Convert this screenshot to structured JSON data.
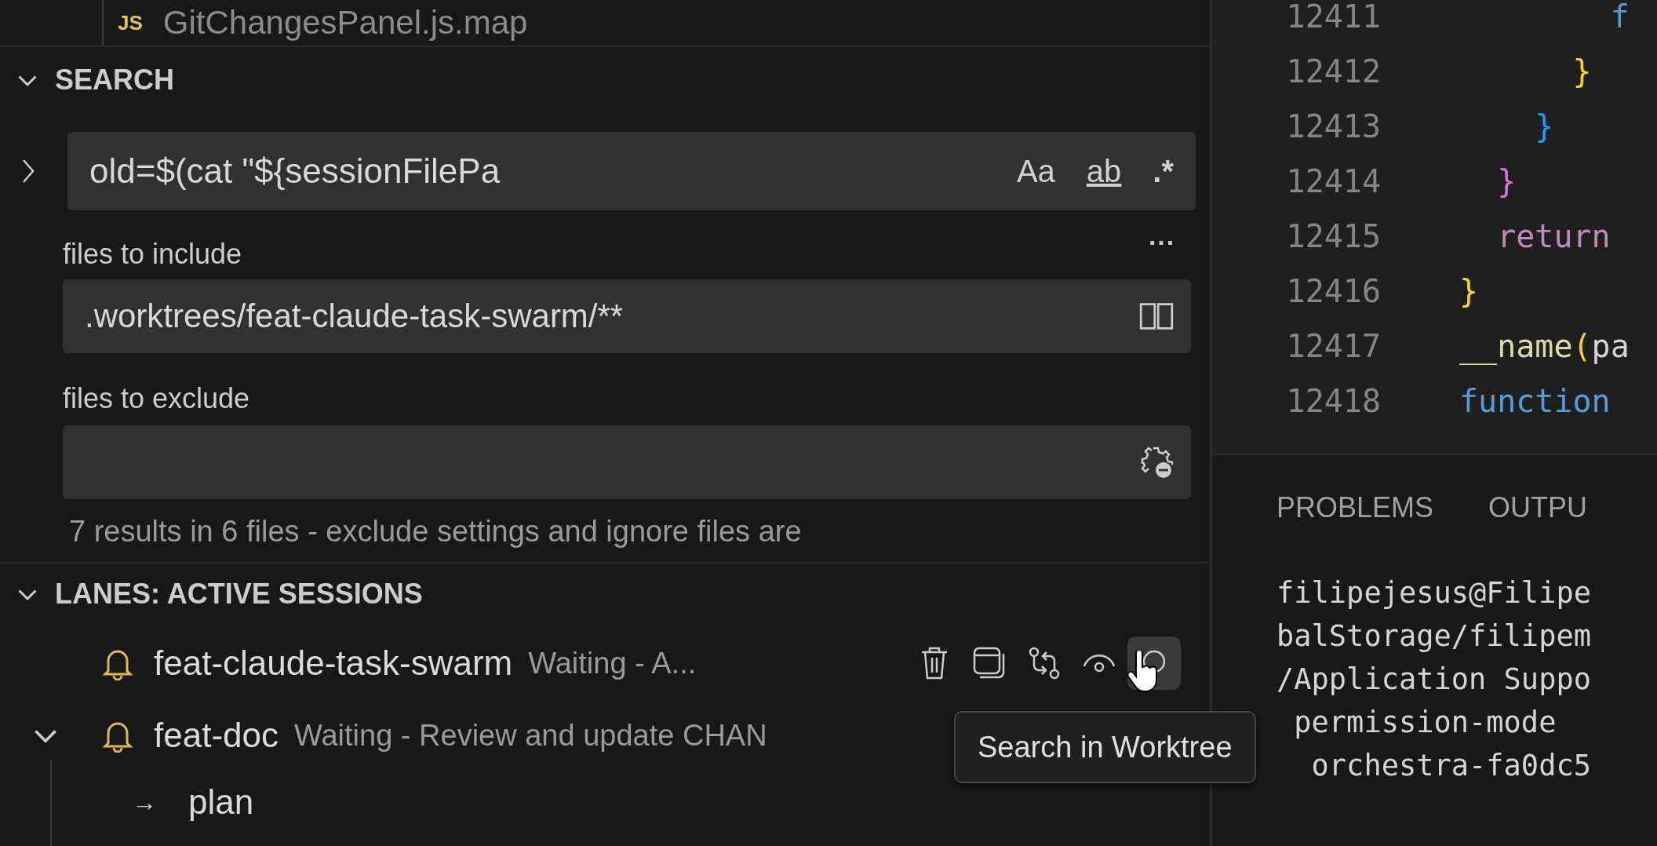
{
  "explorer": {
    "file": {
      "icon_text": "JS",
      "name": "GitChangesPanel.js.map"
    }
  },
  "search": {
    "title": "SEARCH",
    "expanded": true,
    "query": "old=$(cat \"${sessionFilePa",
    "replace_expanded": false,
    "toggles": [
      {
        "label": "Aa",
        "selected": false
      },
      {
        "label": "ab",
        "selected": false
      },
      {
        "label": ".*",
        "selected": false
      }
    ],
    "more": "···",
    "include_label": "files to include",
    "include_value": ".worktrees/feat-claude-task-swarm/**",
    "exclude_label": "files to exclude",
    "results": "7 results in 6 files - exclude settings and ignore files are"
  },
  "lanes": {
    "title": "LANES: ACTIVE SESSIONS",
    "expanded": true,
    "sessions": [
      {
        "name": "feat-claude-task-swarm",
        "status": "Waiting - A...",
        "hovered": true
      },
      {
        "name": "feat-doc",
        "status": "Waiting - Review and update CHAN",
        "hovered": false,
        "expanded": true,
        "children": [
          {
            "arrow": "→",
            "label": "plan"
          }
        ]
      }
    ]
  },
  "tooltip": "Search in Worktree",
  "editor": {
    "lines": [
      {
        "number": "12411",
        "tokens": [
          {
            "text": "        f",
            "kind": "storage"
          }
        ]
      },
      {
        "number": "12412",
        "tokens": [
          {
            "text": "      }",
            "kind": "brace-1"
          }
        ]
      },
      {
        "number": "12413",
        "tokens": [
          {
            "text": "    }",
            "kind": "brace-3"
          }
        ]
      },
      {
        "number": "12414",
        "tokens": [
          {
            "text": "  }",
            "kind": "brace-2"
          }
        ]
      },
      {
        "number": "12415",
        "tokens": [
          {
            "text": "  return",
            "kind": "keyword"
          }
        ]
      },
      {
        "number": "12416",
        "tokens": [
          {
            "text": "}",
            "kind": "brace-1"
          }
        ]
      },
      {
        "number": "12417",
        "tokens": [
          {
            "text": "__name",
            "kind": "function"
          },
          {
            "text": "(",
            "kind": "brace-1"
          },
          {
            "text": "pa",
            "kind": "plain"
          }
        ]
      },
      {
        "number": "12418",
        "tokens": [
          {
            "text": "function",
            "kind": "storage"
          }
        ]
      }
    ]
  },
  "panel": {
    "tabs": [
      {
        "label": "PROBLEMS",
        "selected": false
      },
      {
        "label": "OUTPU",
        "selected": false
      }
    ],
    "terminal": [
      "filipejesus@Filipe",
      "balStorage/filipem",
      "/Application Suppo",
      " permission-mode",
      "  orchestra-fa0dc5"
    ]
  }
}
